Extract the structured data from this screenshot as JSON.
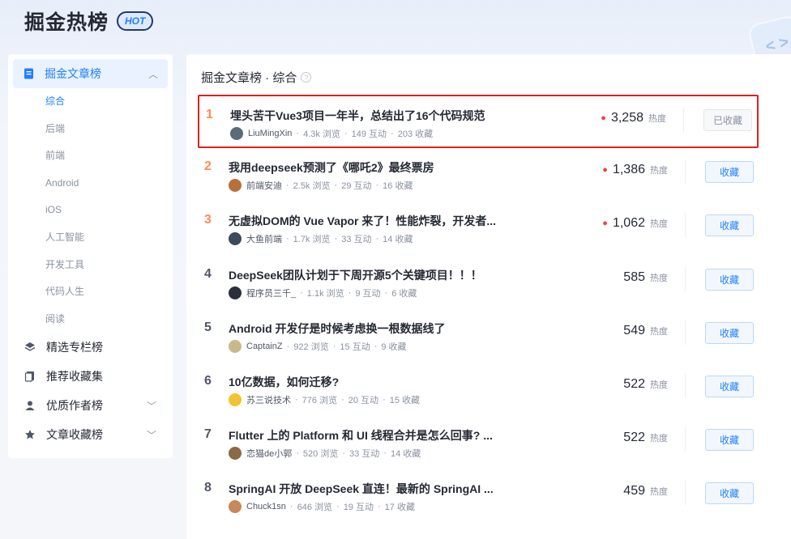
{
  "header": {
    "title": "掘金热榜",
    "badge": "HOT",
    "deco_glyph": "< >"
  },
  "sidebar": {
    "main": {
      "label": "掘金文章榜",
      "icon": "document-icon",
      "expanded": true
    },
    "subs": [
      "综合",
      "后端",
      "前端",
      "Android",
      "iOS",
      "人工智能",
      "开发工具",
      "代码人生",
      "阅读"
    ],
    "active_sub": 0,
    "items": [
      {
        "label": "精选专栏榜",
        "icon": "layers-icon",
        "chevron": false
      },
      {
        "label": "推荐收藏集",
        "icon": "collection-icon",
        "chevron": false
      },
      {
        "label": "优质作者榜",
        "icon": "user-icon",
        "chevron": true
      },
      {
        "label": "文章收藏榜",
        "icon": "star-icon",
        "chevron": true
      }
    ]
  },
  "main": {
    "heading": "掘金文章榜 · 综合",
    "hot_label": "热度",
    "articles": [
      {
        "rank": "1",
        "title": "埋头苦干Vue3项目一年半，总结出了16个代码规范",
        "author": "LiuMingXin",
        "views": "4.3k 浏览",
        "interactions": "149 互动",
        "collects": "203 收藏",
        "hot": "3,258",
        "btn": "已收藏",
        "collected": true,
        "avatar_color": "#5a6b7a"
      },
      {
        "rank": "2",
        "title": "我用deepseek预测了《哪吒2》最终票房",
        "author": "前端安迪",
        "views": "2.5k 浏览",
        "interactions": "29 互动",
        "collects": "16 收藏",
        "hot": "1,386",
        "btn": "收藏",
        "collected": false,
        "avatar_color": "#b5703c"
      },
      {
        "rank": "3",
        "title": "无虚拟DOM的 Vue Vapor 来了！性能炸裂，开发者...",
        "author": "大鱼前端",
        "views": "1.7k 浏览",
        "interactions": "33 互动",
        "collects": "14 收藏",
        "hot": "1,062",
        "btn": "收藏",
        "collected": false,
        "avatar_color": "#3b4a5c"
      },
      {
        "rank": "4",
        "title": "DeepSeek团队计划于下周开源5个关键项目！！！",
        "author": "程序员三千_",
        "views": "1.1k 浏览",
        "interactions": "9 互动",
        "collects": "6 收藏",
        "hot": "585",
        "btn": "收藏",
        "collected": false,
        "avatar_color": "#2b2f3a"
      },
      {
        "rank": "5",
        "title": "Android 开发仔是时候考虑换一根数据线了",
        "author": "CaptainZ",
        "views": "922 浏览",
        "interactions": "15 互动",
        "collects": "9 收藏",
        "hot": "549",
        "btn": "收藏",
        "collected": false,
        "avatar_color": "#c9b98a"
      },
      {
        "rank": "6",
        "title": "10亿数据，如何迁移?",
        "author": "苏三说技术",
        "views": "776 浏览",
        "interactions": "20 互动",
        "collects": "15 收藏",
        "hot": "522",
        "btn": "收藏",
        "collected": false,
        "avatar_color": "#f1c232"
      },
      {
        "rank": "7",
        "title": "Flutter 上的 Platform 和 UI 线程合并是怎么回事? ...",
        "author": "恋猫de小郭",
        "views": "520 浏览",
        "interactions": "33 互动",
        "collects": "14 收藏",
        "hot": "522",
        "btn": "收藏",
        "collected": false,
        "avatar_color": "#8a6a45"
      },
      {
        "rank": "8",
        "title": "SpringAI 开放 DeepSeek 直连！最新的 SpringAI ...",
        "author": "Chuck1sn",
        "views": "646 浏览",
        "interactions": "19 互动",
        "collects": "17 收藏",
        "hot": "459",
        "btn": "收藏",
        "collected": false,
        "avatar_color": "#c7885a"
      }
    ]
  },
  "colors": {
    "accent": "#1e80ff",
    "highlight_border": "#e0201c",
    "flame": "#f53f3f",
    "top_rank": "#ff8a55"
  }
}
